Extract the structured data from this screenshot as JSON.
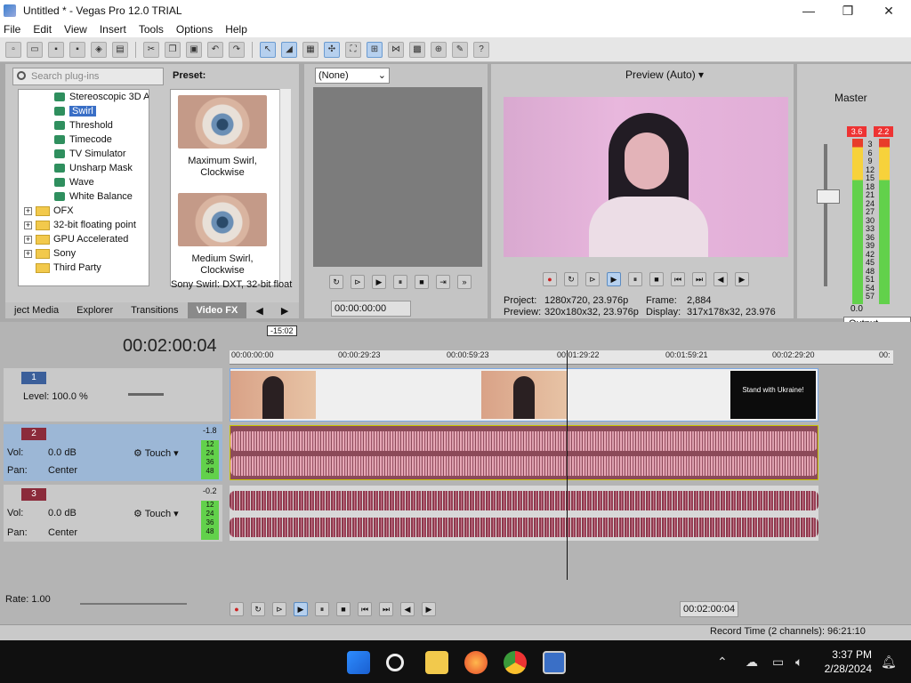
{
  "window": {
    "title": "Untitled * - Vegas Pro 12.0 TRIAL",
    "minimize": "—",
    "maximize": "❐",
    "close": "✕"
  },
  "menu": [
    "File",
    "Edit",
    "View",
    "Insert",
    "Tools",
    "Options",
    "Help"
  ],
  "plugins": {
    "search_placeholder": "Search plug-ins",
    "items": [
      {
        "label": "Stereoscopic 3D A",
        "type": "fx"
      },
      {
        "label": "Swirl",
        "type": "fx",
        "selected": true
      },
      {
        "label": "Threshold",
        "type": "fx"
      },
      {
        "label": "Timecode",
        "type": "fx"
      },
      {
        "label": "TV Simulator",
        "type": "fx"
      },
      {
        "label": "Unsharp Mask",
        "type": "fx"
      },
      {
        "label": "Wave",
        "type": "fx"
      },
      {
        "label": "White Balance",
        "type": "fx"
      },
      {
        "label": "OFX",
        "type": "folder"
      },
      {
        "label": "32-bit floating point",
        "type": "folder"
      },
      {
        "label": "GPU Accelerated",
        "type": "folder"
      },
      {
        "label": "Sony",
        "type": "folder"
      },
      {
        "label": "Third Party",
        "type": "folder"
      }
    ],
    "preset_label": "Preset:",
    "presets": [
      {
        "line1": "Maximum Swirl,",
        "line2": "Clockwise"
      },
      {
        "line1": "Medium Swirl,",
        "line2": "Clockwise"
      }
    ],
    "status": "Sony Swirl: DXT, 32-bit float",
    "tabs": [
      "ject Media",
      "Explorer",
      "Transitions",
      "Video FX"
    ]
  },
  "trimmer": {
    "select_value": "(None)",
    "time": "00:00:00:00"
  },
  "preview": {
    "mode": "Preview (Auto)",
    "project_label": "Project:",
    "project_value": "1280x720, 23.976p",
    "frame_label": "Frame:",
    "frame_value": "2,884",
    "preview_label": "Preview:",
    "preview_value": "320x180x32, 23.976p",
    "display_label": "Display:",
    "display_value": "317x178x32, 23.976"
  },
  "master": {
    "label": "Master",
    "peak_left": "3.6",
    "peak_right": "2.2",
    "scale": [
      "3",
      "6",
      "9",
      "12",
      "15",
      "18",
      "21",
      "24",
      "27",
      "30",
      "33",
      "36",
      "39",
      "42",
      "45",
      "48",
      "51",
      "54",
      "57"
    ],
    "bottom_value": "0.0",
    "tooltip": "Output Meter"
  },
  "timeline": {
    "timecode": "00:02:00:04",
    "marker": "-15:02",
    "ruler": [
      "00:00:00:00",
      "00:00:29:23",
      "00:00:59:23",
      "00:01:29:22",
      "00:01:59:21",
      "00:02:29:20",
      "00:"
    ],
    "tracks": [
      {
        "num": "1",
        "level": "Level: 100.0 %"
      },
      {
        "num": "2",
        "vol": "Vol:",
        "vol_value": "0.0 dB",
        "pan": "Pan:",
        "pan_value": "Center",
        "mode": "Touch",
        "meter": "-1.8"
      },
      {
        "num": "3",
        "vol": "Vol:",
        "vol_value": "0.0 dB",
        "pan": "Pan:",
        "pan_value": "Center",
        "mode": "Touch",
        "meter": "-0.2"
      }
    ],
    "meter_scale": [
      "12",
      "24",
      "36",
      "48"
    ],
    "end_slate_text": "Stand with Ukraine!",
    "rate": "Rate: 1.00",
    "bottom_timecode": "00:02:00:04",
    "record_time": "Record Time (2 channels): 96:21:10"
  },
  "taskbar": {
    "time": "3:37 PM",
    "date": "2/28/2024"
  }
}
